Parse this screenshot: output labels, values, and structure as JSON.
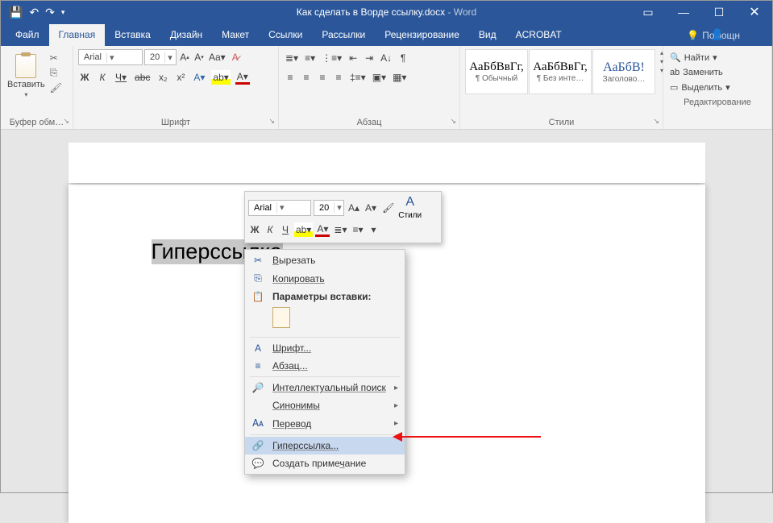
{
  "title": {
    "doc": "Как сделать в Ворде ссылку.docx",
    "app": "Word"
  },
  "tabs": {
    "file": "Файл",
    "home": "Главная",
    "insert": "Вставка",
    "design": "Дизайн",
    "layout": "Макет",
    "refs": "Ссылки",
    "mailings": "Рассылки",
    "review": "Рецензирование",
    "view": "Вид",
    "acrobat": "ACROBAT"
  },
  "tell": "Помощн",
  "ribbon": {
    "clipboard": {
      "paste": "Вставить",
      "label": "Буфер обм…"
    },
    "font": {
      "name": "Arial",
      "size": "20",
      "label": "Шрифт",
      "bold": "Ж",
      "italic": "К",
      "underline": "Ч",
      "strike": "abc",
      "sub": "x₂",
      "sup": "x²"
    },
    "paragraph": {
      "label": "Абзац"
    },
    "styles": {
      "label": "Стили",
      "normal_sample": "АаБбВвГг,",
      "normal": "¶ Обычный",
      "nospace_sample": "АаБбВвГг,",
      "nospace": "¶ Без инте…",
      "heading_sample": "АаБбВ!",
      "heading": "Заголово…"
    },
    "editing": {
      "find": "Найти",
      "replace": "Заменить",
      "select": "Выделить",
      "label": "Редактирование"
    }
  },
  "mini": {
    "font": "Arial",
    "size": "20",
    "styles": "Стили",
    "bold": "Ж",
    "italic": "К",
    "underline": "Ч"
  },
  "doc": {
    "text": "Гиперссылка"
  },
  "ctx": {
    "cut": "Вырезать",
    "copy": "Копировать",
    "paste_options": "Параметры вставки:",
    "font": "Шрифт...",
    "paragraph": "Абзац...",
    "smart": "Интеллектуальный поиск",
    "synonyms": "Синонимы",
    "translate": "Перевод",
    "hyperlink": "Гиперссылка...",
    "comment": "Создать примечание"
  }
}
